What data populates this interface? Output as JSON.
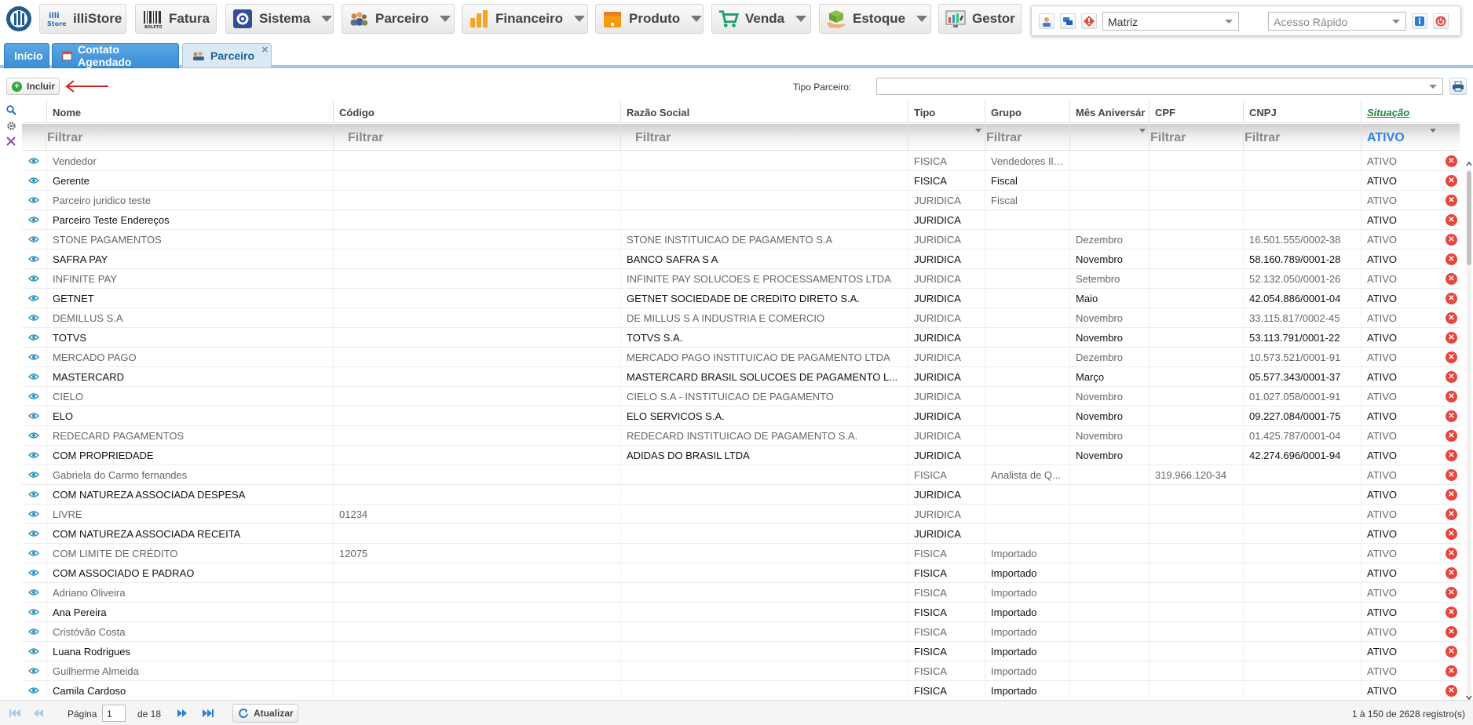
{
  "menu": [
    {
      "label": "illiStore",
      "icon": "illistore-icon",
      "caret": false
    },
    {
      "label": "Fatura",
      "icon": "barcode-icon",
      "caret": false
    },
    {
      "label": "Sistema",
      "icon": "gear-icon",
      "caret": true
    },
    {
      "label": "Parceiro",
      "icon": "people-icon",
      "caret": true
    },
    {
      "label": "Financeiro",
      "icon": "bar-chart-icon",
      "caret": true
    },
    {
      "label": "Produto",
      "icon": "box-icon",
      "caret": true
    },
    {
      "label": "Venda",
      "icon": "cart-icon",
      "caret": true
    },
    {
      "label": "Estoque",
      "icon": "hand-box-icon",
      "caret": true
    },
    {
      "label": "Gestor",
      "icon": "dashboard-icon",
      "caret": false
    }
  ],
  "quick": {
    "branch": "Matriz",
    "quick_access_placeholder": "Acesso Rápido"
  },
  "tabs": [
    {
      "label": "Início",
      "icon": ""
    },
    {
      "label": "Contato Agendado",
      "icon": "calendar-icon"
    },
    {
      "label": "Parceiro",
      "icon": "people-icon",
      "active": true
    }
  ],
  "toolbar": {
    "include_label": "Incluir",
    "tipo_label": "Tipo Parceiro:"
  },
  "columns": [
    "Nome",
    "Código",
    "Razão Social",
    "Tipo",
    "Grupo",
    "Mês Aniversár",
    "CPF",
    "CNPJ",
    "Situação"
  ],
  "filters": {
    "placeholder": "Filtrar",
    "situacao": "ATIVO"
  },
  "rows": [
    {
      "nome": "Vendedor",
      "codigo": "",
      "razao": "",
      "tipo": "FISICA",
      "grupo": "Vendedores Ill...",
      "mes": "",
      "cpf": "",
      "cnpj": "",
      "situacao": "ATIVO",
      "style": "dim"
    },
    {
      "nome": "Gerente",
      "codigo": "",
      "razao": "",
      "tipo": "FISICA",
      "grupo": "Fiscal",
      "mes": "",
      "cpf": "",
      "cnpj": "",
      "situacao": "ATIVO",
      "style": "dark"
    },
    {
      "nome": "Parceiro juridico teste",
      "codigo": "",
      "razao": "",
      "tipo": "JURIDICA",
      "grupo": "Fiscal",
      "mes": "",
      "cpf": "",
      "cnpj": "",
      "situacao": "ATIVO",
      "style": "dim"
    },
    {
      "nome": "Parceiro Teste Endereços",
      "codigo": "",
      "razao": "",
      "tipo": "JURIDICA",
      "grupo": "",
      "mes": "",
      "cpf": "",
      "cnpj": "",
      "situacao": "ATIVO",
      "style": "dark"
    },
    {
      "nome": "STONE PAGAMENTOS",
      "codigo": "",
      "razao": "STONE INSTITUICAO DE PAGAMENTO S.A",
      "tipo": "JURIDICA",
      "grupo": "",
      "mes": "Dezembro",
      "cpf": "",
      "cnpj": "16.501.555/0002-38",
      "situacao": "ATIVO",
      "style": "dim"
    },
    {
      "nome": "SAFRA PAY",
      "codigo": "",
      "razao": "BANCO SAFRA S A",
      "tipo": "JURIDICA",
      "grupo": "",
      "mes": "Novembro",
      "cpf": "",
      "cnpj": "58.160.789/0001-28",
      "situacao": "ATIVO",
      "style": "dark"
    },
    {
      "nome": "INFINITE PAY",
      "codigo": "",
      "razao": "INFINITE PAY SOLUCOES E PROCESSAMENTOS LTDA",
      "tipo": "JURIDICA",
      "grupo": "",
      "mes": "Setembro",
      "cpf": "",
      "cnpj": "52.132.050/0001-26",
      "situacao": "ATIVO",
      "style": "dim"
    },
    {
      "nome": "GETNET",
      "codigo": "",
      "razao": "GETNET SOCIEDADE DE CREDITO DIRETO S.A.",
      "tipo": "JURIDICA",
      "grupo": "",
      "mes": "Maio",
      "cpf": "",
      "cnpj": "42.054.886/0001-04",
      "situacao": "ATIVO",
      "style": "dark"
    },
    {
      "nome": "DEMILLUS S.A",
      "codigo": "",
      "razao": "DE MILLUS S A INDUSTRIA E COMERCIO",
      "tipo": "JURIDICA",
      "grupo": "",
      "mes": "Novembro",
      "cpf": "",
      "cnpj": "33.115.817/0002-45",
      "situacao": "ATIVO",
      "style": "dim"
    },
    {
      "nome": "TOTVS",
      "codigo": "",
      "razao": "TOTVS S.A.",
      "tipo": "JURIDICA",
      "grupo": "",
      "mes": "Novembro",
      "cpf": "",
      "cnpj": "53.113.791/0001-22",
      "situacao": "ATIVO",
      "style": "dark"
    },
    {
      "nome": "MERCADO PAGO",
      "codigo": "",
      "razao": "MERCADO PAGO INSTITUICAO DE PAGAMENTO LTDA",
      "tipo": "JURIDICA",
      "grupo": "",
      "mes": "Dezembro",
      "cpf": "",
      "cnpj": "10.573.521/0001-91",
      "situacao": "ATIVO",
      "style": "dim"
    },
    {
      "nome": "MASTERCARD",
      "codigo": "",
      "razao": "MASTERCARD BRASIL SOLUCOES DE PAGAMENTO L...",
      "tipo": "JURIDICA",
      "grupo": "",
      "mes": "Março",
      "cpf": "",
      "cnpj": "05.577.343/0001-37",
      "situacao": "ATIVO",
      "style": "dark"
    },
    {
      "nome": "CIELO",
      "codigo": "",
      "razao": "CIELO S.A - INSTITUICAO DE PAGAMENTO",
      "tipo": "JURIDICA",
      "grupo": "",
      "mes": "Novembro",
      "cpf": "",
      "cnpj": "01.027.058/0001-91",
      "situacao": "ATIVO",
      "style": "dim"
    },
    {
      "nome": "ELO",
      "codigo": "",
      "razao": "ELO SERVICOS S.A.",
      "tipo": "JURIDICA",
      "grupo": "",
      "mes": "Novembro",
      "cpf": "",
      "cnpj": "09.227.084/0001-75",
      "situacao": "ATIVO",
      "style": "dark"
    },
    {
      "nome": "REDECARD PAGAMENTOS",
      "codigo": "",
      "razao": "REDECARD INSTITUICAO DE PAGAMENTO S.A.",
      "tipo": "JURIDICA",
      "grupo": "",
      "mes": "Novembro",
      "cpf": "",
      "cnpj": "01.425.787/0001-04",
      "situacao": "ATIVO",
      "style": "dim"
    },
    {
      "nome": "COM PROPRIEDADE",
      "codigo": "",
      "razao": "ADIDAS DO BRASIL LTDA",
      "tipo": "JURIDICA",
      "grupo": "",
      "mes": "Novembro",
      "cpf": "",
      "cnpj": "42.274.696/0001-94",
      "situacao": "ATIVO",
      "style": "dark"
    },
    {
      "nome": "Gabriela do Carmo fernandes",
      "codigo": "",
      "razao": "",
      "tipo": "FISICA",
      "grupo": "Analista de Q...",
      "mes": "",
      "cpf": "319.966.120-34",
      "cnpj": "",
      "situacao": "ATIVO",
      "style": "dim"
    },
    {
      "nome": "COM NATUREZA ASSOCIADA DESPESA",
      "codigo": "",
      "razao": "",
      "tipo": "JURIDICA",
      "grupo": "",
      "mes": "",
      "cpf": "",
      "cnpj": "",
      "situacao": "ATIVO",
      "style": "dark"
    },
    {
      "nome": "LIVRE",
      "codigo": "01234",
      "razao": "",
      "tipo": "JURIDICA",
      "grupo": "",
      "mes": "",
      "cpf": "",
      "cnpj": "",
      "situacao": "ATIVO",
      "style": "dim"
    },
    {
      "nome": "COM NATUREZA ASSOCIADA RECEITA",
      "codigo": "",
      "razao": "",
      "tipo": "JURIDICA",
      "grupo": "",
      "mes": "",
      "cpf": "",
      "cnpj": "",
      "situacao": "ATIVO",
      "style": "dark"
    },
    {
      "nome": "COM LIMITE DE CRÉDITO",
      "codigo": "12075",
      "razao": "",
      "tipo": "FISICA",
      "grupo": "Importado",
      "mes": "",
      "cpf": "",
      "cnpj": "",
      "situacao": "ATIVO",
      "style": "dim"
    },
    {
      "nome": "COM ASSOCIADO E PADRAO",
      "codigo": "",
      "razao": "",
      "tipo": "FISICA",
      "grupo": "Importado",
      "mes": "",
      "cpf": "",
      "cnpj": "",
      "situacao": "ATIVO",
      "style": "dark"
    },
    {
      "nome": "Adriano Oliveira",
      "codigo": "",
      "razao": "",
      "tipo": "FISICA",
      "grupo": "Importado",
      "mes": "",
      "cpf": "",
      "cnpj": "",
      "situacao": "ATIVO",
      "style": "dim"
    },
    {
      "nome": "Ana Pereira",
      "codigo": "",
      "razao": "",
      "tipo": "FISICA",
      "grupo": "Importado",
      "mes": "",
      "cpf": "",
      "cnpj": "",
      "situacao": "ATIVO",
      "style": "dark"
    },
    {
      "nome": "Cristóvão Costa",
      "codigo": "",
      "razao": "",
      "tipo": "FISICA",
      "grupo": "Importado",
      "mes": "",
      "cpf": "",
      "cnpj": "",
      "situacao": "ATIVO",
      "style": "dim"
    },
    {
      "nome": "Luana Rodrigues",
      "codigo": "",
      "razao": "",
      "tipo": "FISICA",
      "grupo": "Importado",
      "mes": "",
      "cpf": "",
      "cnpj": "",
      "situacao": "ATIVO",
      "style": "dark"
    },
    {
      "nome": "Guilherme Almeida",
      "codigo": "",
      "razao": "",
      "tipo": "FISICA",
      "grupo": "Importado",
      "mes": "",
      "cpf": "",
      "cnpj": "",
      "situacao": "ATIVO",
      "style": "dim"
    },
    {
      "nome": "Camila Cardoso",
      "codigo": "",
      "razao": "",
      "tipo": "FISICA",
      "grupo": "Importado",
      "mes": "",
      "cpf": "",
      "cnpj": "",
      "situacao": "ATIVO",
      "style": "dark"
    }
  ],
  "pager": {
    "page_label": "Página",
    "page": "1",
    "of_label": "de 18",
    "refresh_label": "Atualizar",
    "count": "1 à 150 de 2628 registro(s)"
  },
  "colors": {
    "tab_blue": "#3a8fd6",
    "accent": "#2e86de",
    "delete": "#e8453c",
    "add": "#3aa33a"
  }
}
